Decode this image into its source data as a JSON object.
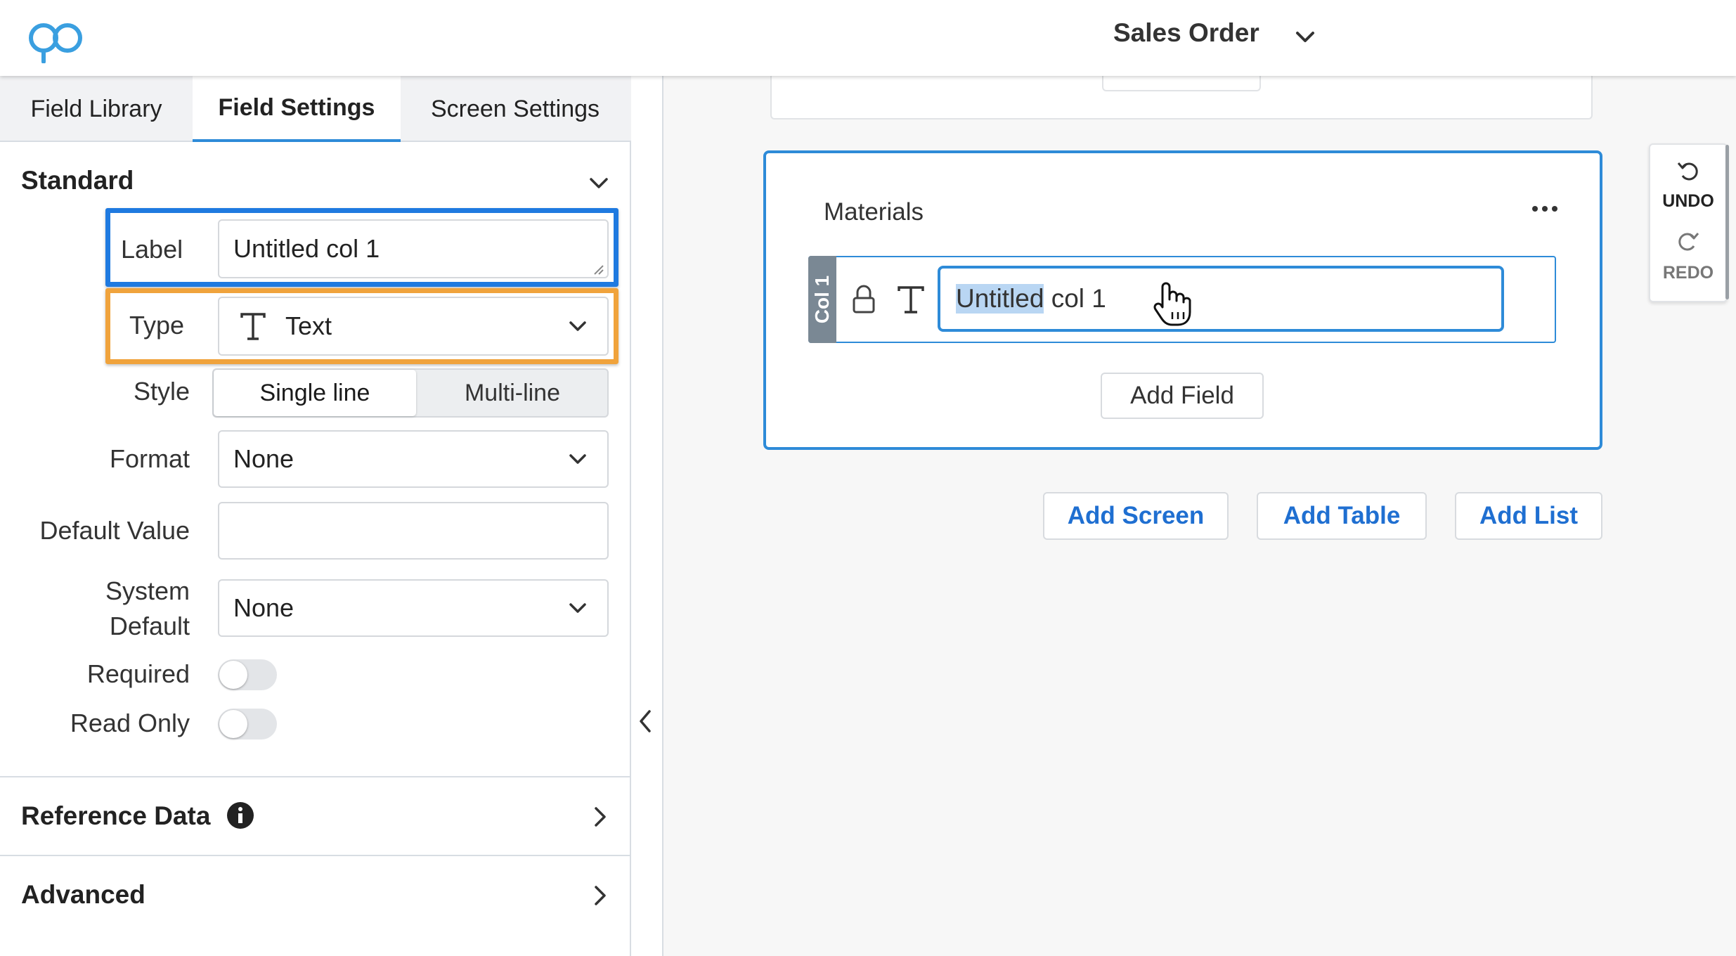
{
  "header": {
    "title": "Sales Order"
  },
  "tabs": [
    {
      "label": "Field Library"
    },
    {
      "label": "Field Settings"
    },
    {
      "label": "Screen Settings"
    }
  ],
  "standard": {
    "title": "Standard",
    "label_field": {
      "label": "Label",
      "value": "Untitled col 1"
    },
    "type_field": {
      "label": "Type",
      "value": "Text",
      "icon": "text-type-icon"
    },
    "style_field": {
      "label": "Style",
      "options": [
        "Single line",
        "Multi-line"
      ],
      "selected": "Single line"
    },
    "format_field": {
      "label": "Format",
      "value": "None"
    },
    "default_value_field": {
      "label": "Default Value",
      "value": ""
    },
    "system_default_field": {
      "label_line1": "System",
      "label_line2": "Default",
      "value": "None"
    },
    "required": {
      "label": "Required",
      "on": false
    },
    "read_only": {
      "label": "Read Only",
      "on": false
    }
  },
  "reference_data": {
    "title": "Reference Data"
  },
  "advanced": {
    "title": "Advanced"
  },
  "canvas": {
    "card_title": "Materials",
    "column_tag": "Col 1",
    "column_input": {
      "selected_text": "Untitled",
      "rest_text": " col 1"
    },
    "add_field": "Add Field",
    "add_screen": "Add Screen",
    "add_table": "Add Table",
    "add_list": "Add List"
  },
  "history": {
    "undo": "UNDO",
    "redo": "REDO"
  },
  "colors": {
    "accent_blue": "#2e8bd8",
    "highlight_blue": "#1f7ae0",
    "highlight_orange": "#f0a33c",
    "link_blue": "#1f6fd1"
  }
}
